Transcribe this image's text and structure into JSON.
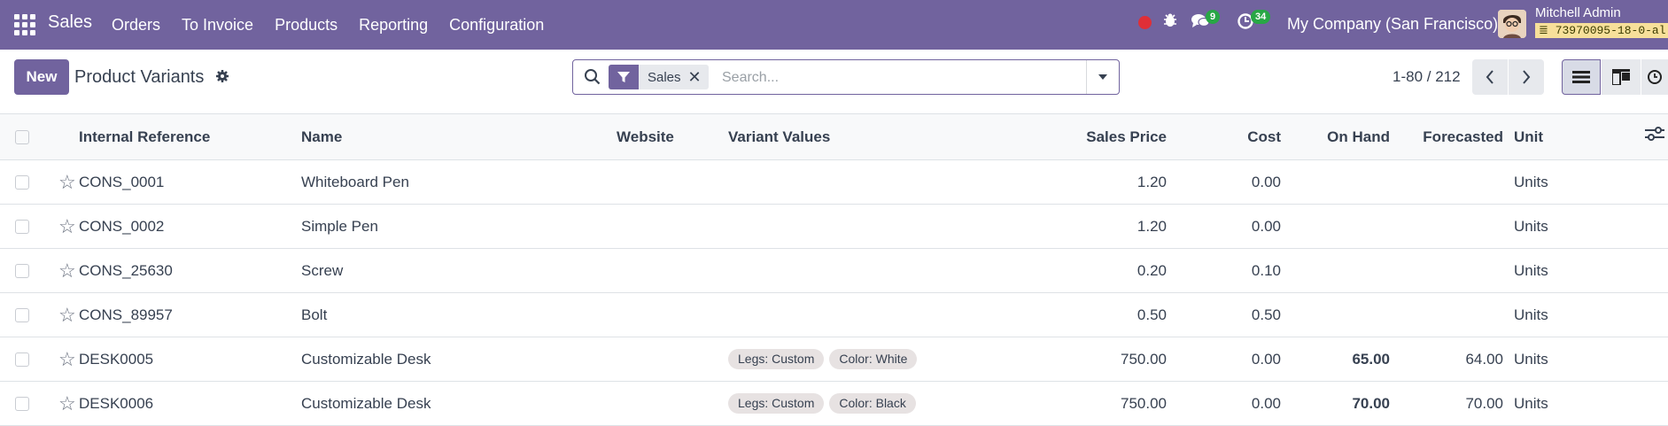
{
  "navbar": {
    "app_name": "Sales",
    "menu": [
      "Orders",
      "To Invoice",
      "Products",
      "Reporting",
      "Configuration"
    ],
    "chat_count": "9",
    "activity_count": "34",
    "company": "My Company (San Francisco)",
    "user": "Mitchell Admin",
    "database": "73970095-18-0-al",
    "colors": {
      "bar": "#71639e",
      "badge": "#28a745",
      "recording": "#e02f37"
    }
  },
  "control": {
    "new_label": "New",
    "title": "Product Variants",
    "facet": "Sales",
    "search_placeholder": "Search...",
    "pager": "1-80 / 212"
  },
  "table": {
    "headers": {
      "ref": "Internal Reference",
      "name": "Name",
      "website": "Website",
      "variants": "Variant Values",
      "price": "Sales Price",
      "cost": "Cost",
      "onhand": "On Hand",
      "forecast": "Forecasted",
      "unit": "Unit"
    },
    "rows": [
      {
        "ref": "CONS_0001",
        "name": "Whiteboard Pen",
        "tags": [],
        "price": "1.20",
        "cost": "0.00",
        "onhand": "",
        "forecast": "",
        "unit": "Units"
      },
      {
        "ref": "CONS_0002",
        "name": "Simple Pen",
        "tags": [],
        "price": "1.20",
        "cost": "0.00",
        "onhand": "",
        "forecast": "",
        "unit": "Units"
      },
      {
        "ref": "CONS_25630",
        "name": "Screw",
        "tags": [],
        "price": "0.20",
        "cost": "0.10",
        "onhand": "",
        "forecast": "",
        "unit": "Units"
      },
      {
        "ref": "CONS_89957",
        "name": "Bolt",
        "tags": [],
        "price": "0.50",
        "cost": "0.50",
        "onhand": "",
        "forecast": "",
        "unit": "Units"
      },
      {
        "ref": "DESK0005",
        "name": "Customizable Desk",
        "tags": [
          "Legs: Custom",
          "Color: White"
        ],
        "price": "750.00",
        "cost": "0.00",
        "onhand": "65.00",
        "forecast": "64.00",
        "unit": "Units"
      },
      {
        "ref": "DESK0006",
        "name": "Customizable Desk",
        "tags": [
          "Legs: Custom",
          "Color: Black"
        ],
        "price": "750.00",
        "cost": "0.00",
        "onhand": "70.00",
        "forecast": "70.00",
        "unit": "Units"
      }
    ]
  }
}
